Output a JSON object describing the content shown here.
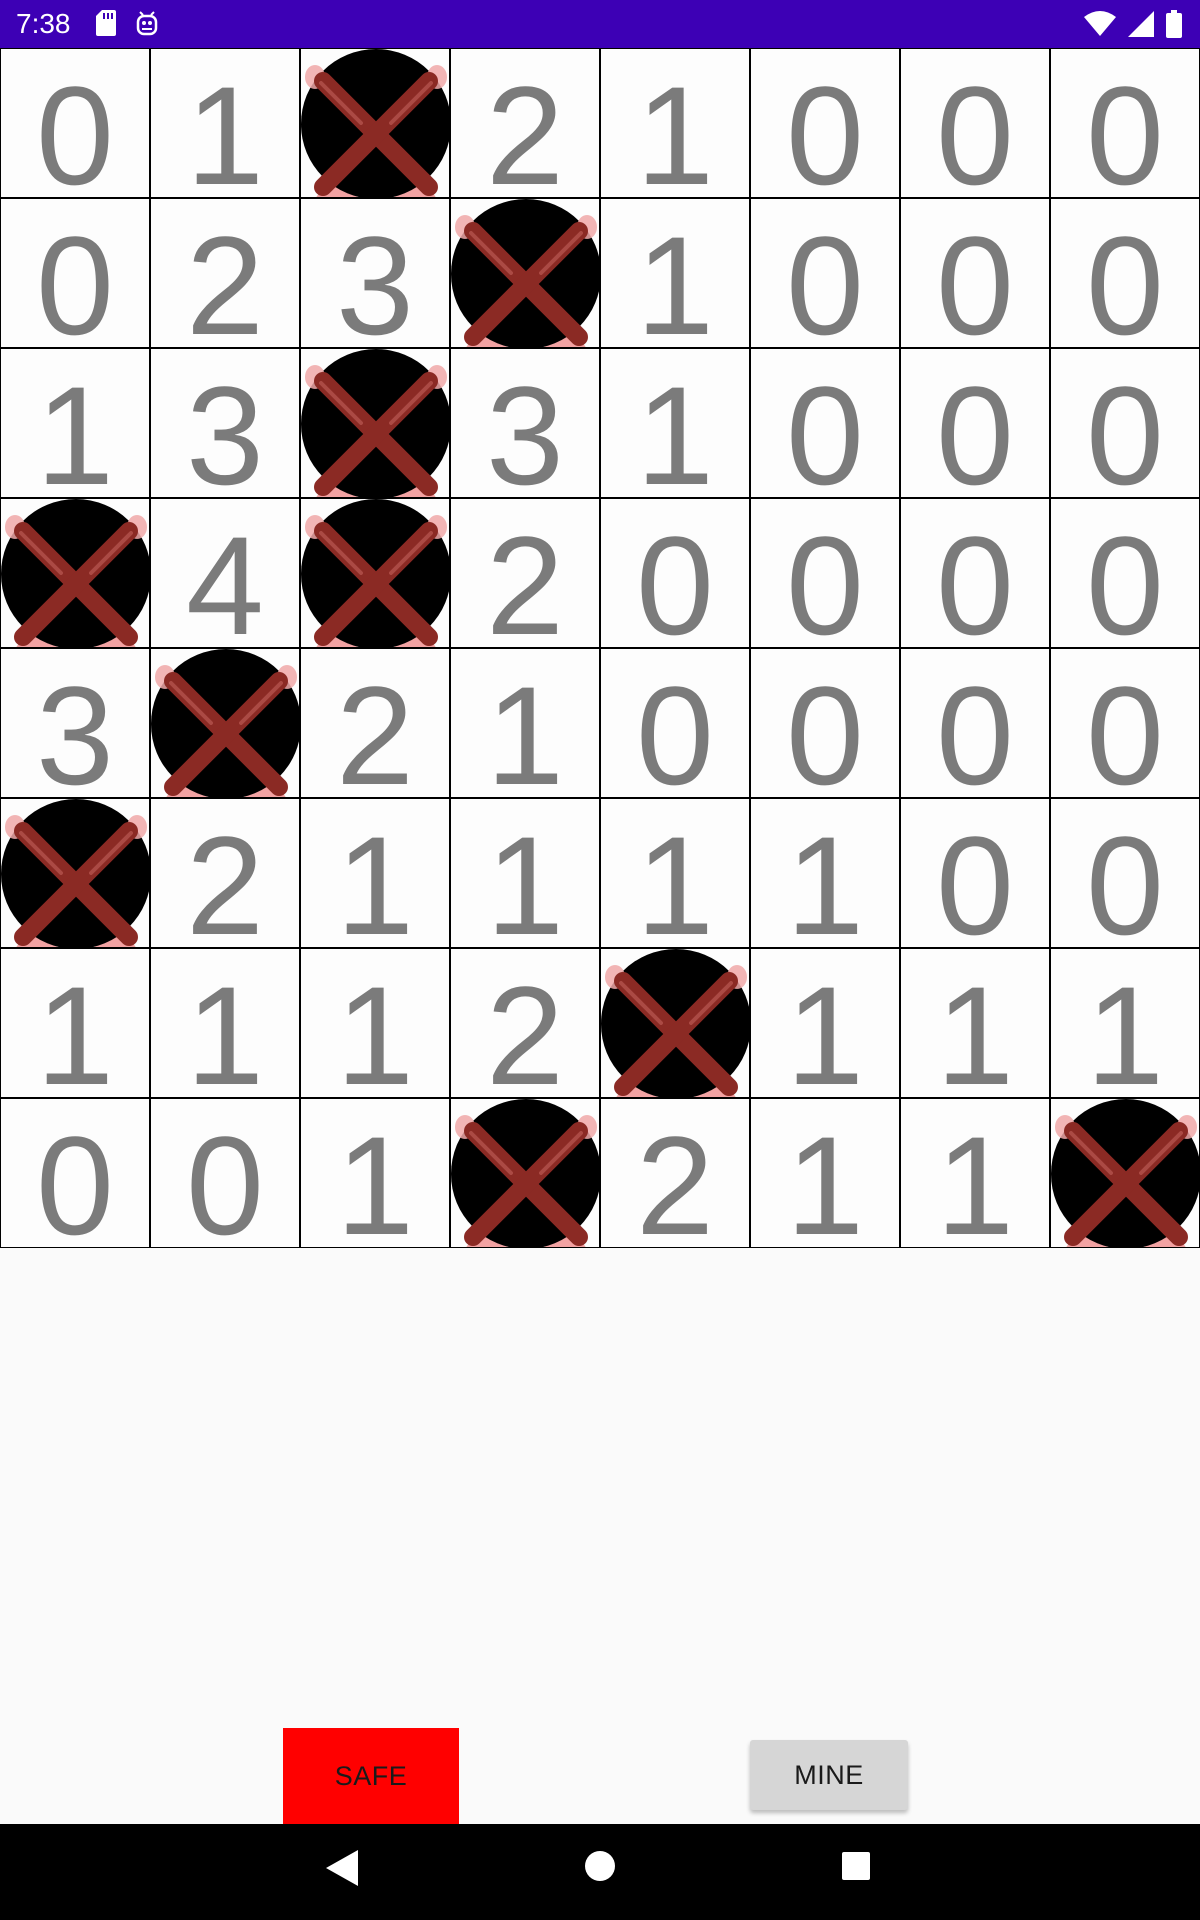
{
  "status_bar": {
    "time": "7:38",
    "left_icons": [
      "sd-card-icon",
      "robot-icon"
    ],
    "right_icons": [
      "wifi-icon",
      "cell-signal-icon",
      "battery-icon"
    ],
    "background": "#3d00b5"
  },
  "board": {
    "rows": 8,
    "cols": 8,
    "cells": [
      [
        "0",
        "1",
        "M",
        "2",
        "1",
        "0",
        "0",
        "0"
      ],
      [
        "0",
        "2",
        "3",
        "M",
        "1",
        "0",
        "0",
        "0"
      ],
      [
        "1",
        "3",
        "M",
        "3",
        "1",
        "0",
        "0",
        "0"
      ],
      [
        "M",
        "4",
        "M",
        "2",
        "0",
        "0",
        "0",
        "0"
      ],
      [
        "3",
        "M",
        "2",
        "1",
        "0",
        "0",
        "0",
        "0"
      ],
      [
        "M",
        "2",
        "1",
        "1",
        "1",
        "1",
        "0",
        "0"
      ],
      [
        "1",
        "1",
        "1",
        "2",
        "M",
        "1",
        "1",
        "1"
      ],
      [
        "0",
        "0",
        "1",
        "M",
        "2",
        "1",
        "1",
        "M"
      ]
    ],
    "mine_symbol": "M",
    "mine_icon": "crossed-mine-icon",
    "number_color": "#7b7b7b"
  },
  "controls": {
    "safe_label": "SAFE",
    "mine_label": "MINE",
    "safe_color": "#ff0000",
    "mine_color": "#d6d6d6"
  },
  "nav_bar": {
    "icons": [
      "back-icon",
      "home-icon",
      "recents-icon"
    ]
  }
}
